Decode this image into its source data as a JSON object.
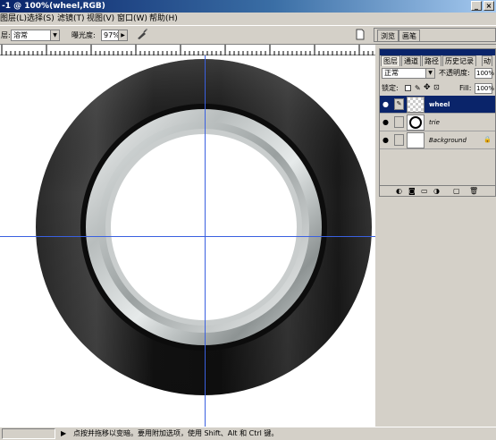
{
  "title": "-1 @ 100%(wheel,RGB)",
  "menu": [
    "图层(L)",
    "选择(S)",
    "滤镜(T)",
    "视图(V)",
    "窗口(W)",
    "帮助(H)"
  ],
  "options": {
    "mode_label": "层:",
    "mode_value": "溶常",
    "exposure_label": "曝光度:",
    "exposure_value": "97%"
  },
  "navigator_tabs": [
    "浏览",
    "画笔"
  ],
  "layers_panel": {
    "tabs": [
      "图层",
      "通道",
      "路径",
      "历史记录",
      "动"
    ],
    "blend_mode": "正常",
    "opacity_label": "不透明度:",
    "opacity_value": "100%",
    "lock_label": "锁定:",
    "fill_label": "Fill:",
    "fill_value": "100%",
    "layers": [
      {
        "name": "wheel",
        "active": true
      },
      {
        "name": "trie",
        "active": false
      },
      {
        "name": "Background",
        "active": false,
        "locked": true
      }
    ]
  },
  "status_text": "点按并拖移以变暗。要用附加选项，使用 Shift、Alt 和 Ctrl 键。",
  "colors": {
    "title_start": "#0a246a",
    "title_end": "#a6caf0",
    "chrome": "#d4d0c8",
    "guide": "#3a60e0",
    "active_layer": "#0a246a"
  },
  "icons": [
    "minimize-icon",
    "close-icon",
    "dodge-tool-icon",
    "airbrush-icon",
    "eye-icon",
    "brush-icon",
    "lock-icon",
    "new-layer-icon",
    "trash-icon"
  ]
}
